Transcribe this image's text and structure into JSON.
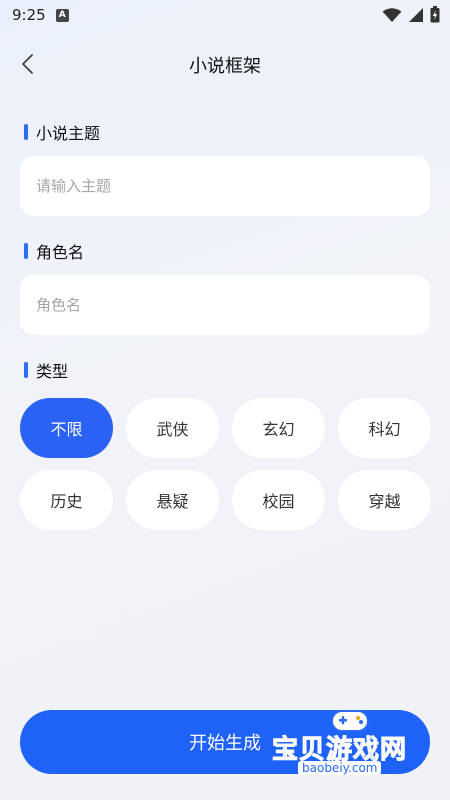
{
  "status_bar": {
    "time": "9:25",
    "a_glyph": "A",
    "icons": [
      "wifi-icon",
      "signal-icon",
      "battery-icon"
    ]
  },
  "header": {
    "title": "小说框架",
    "back_icon": "chevron-left-icon"
  },
  "form": {
    "theme": {
      "label": "小说主题",
      "placeholder": "请输入主题",
      "value": ""
    },
    "role": {
      "label": "角色名",
      "placeholder": "角色名",
      "value": ""
    },
    "genre": {
      "label": "类型",
      "selected": "不限",
      "options": [
        "不限",
        "武侠",
        "玄幻",
        "科幻",
        "历史",
        "悬疑",
        "校园",
        "穿越"
      ]
    }
  },
  "actions": {
    "start_label": "开始生成"
  },
  "watermark": {
    "text": "宝贝游戏网",
    "url": "baobeiy.com"
  },
  "colors": {
    "accent": "#2a62f4",
    "button": "#1e62f8",
    "background": "#f1f2f6"
  }
}
